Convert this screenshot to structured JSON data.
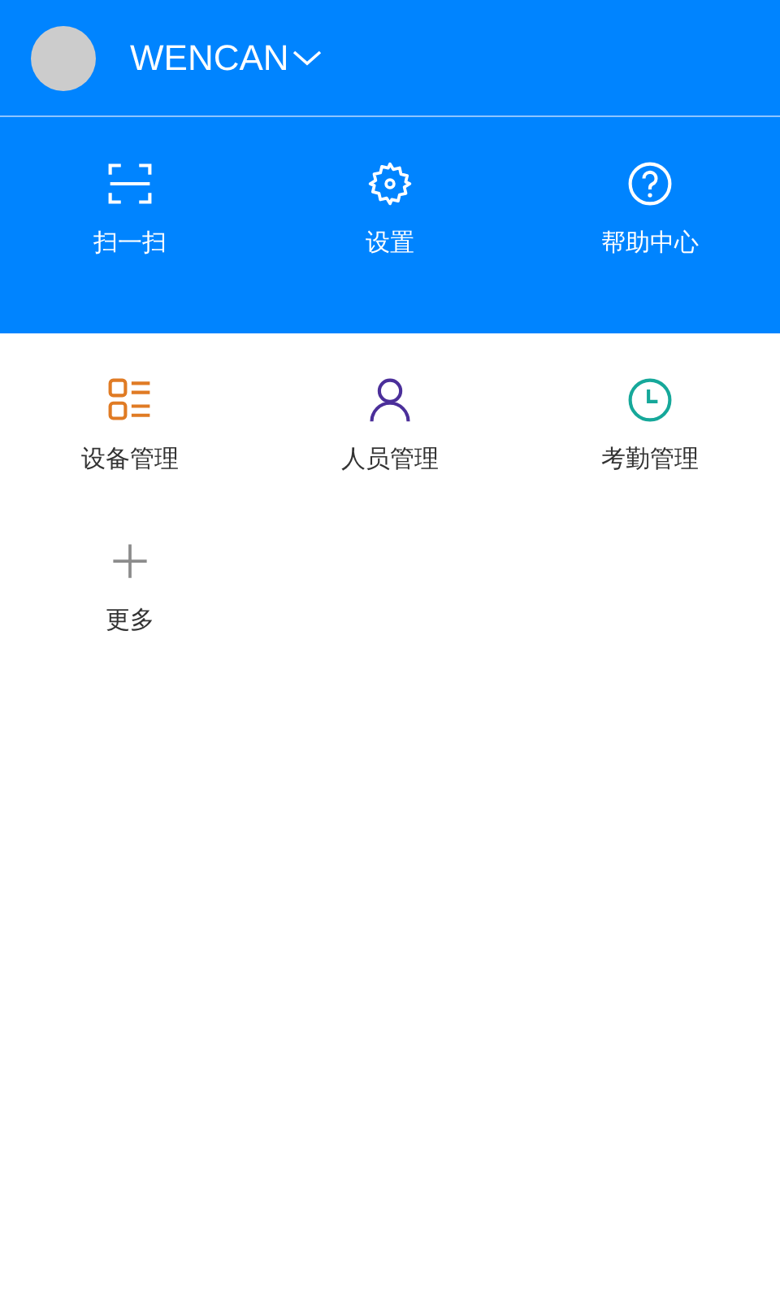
{
  "header": {
    "username": "WENCAN"
  },
  "quick_actions": [
    {
      "kind": "scan",
      "label": "扫一扫"
    },
    {
      "kind": "settings",
      "label": "设置"
    },
    {
      "kind": "help",
      "label": "帮助中心"
    }
  ],
  "modules": [
    {
      "kind": "devices",
      "label": "设备管理",
      "color": "#e07b24"
    },
    {
      "kind": "people",
      "label": "人员管理",
      "color": "#4b2f9a"
    },
    {
      "kind": "attendance",
      "label": "考勤管理",
      "color": "#16a89a"
    },
    {
      "kind": "more",
      "label": "更多",
      "color": "#8c8c8c"
    }
  ]
}
